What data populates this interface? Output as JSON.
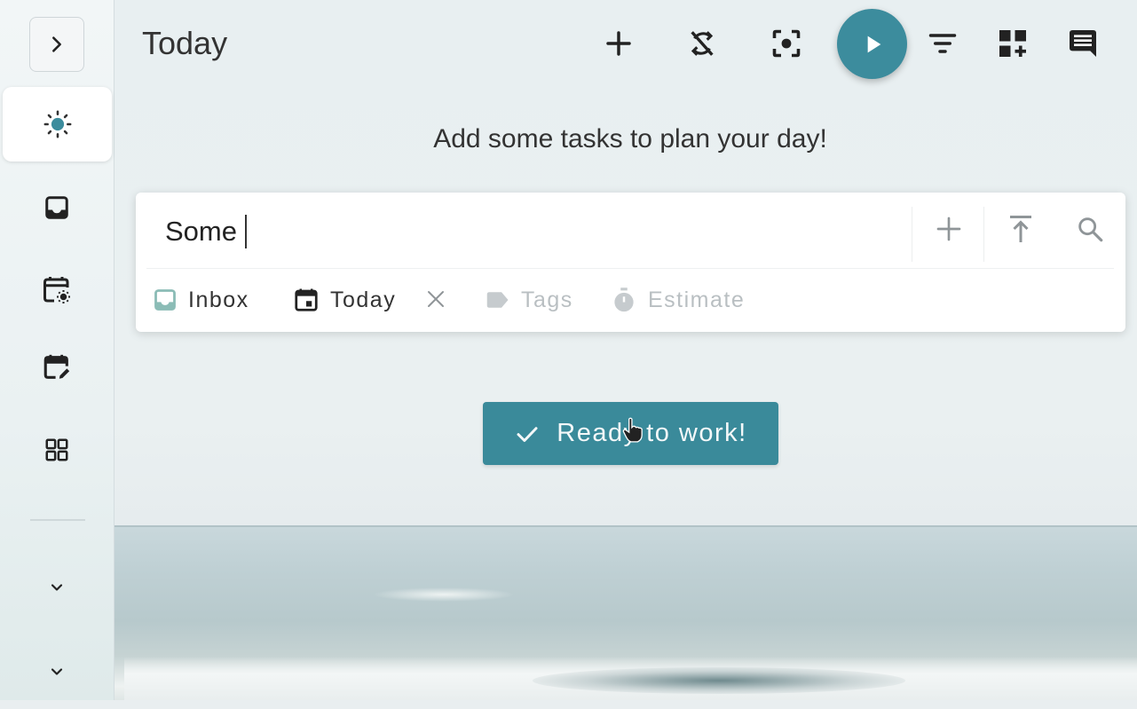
{
  "colors": {
    "accent": "#3c8c9d",
    "text": "#333333",
    "muted": "#b9bfc2",
    "inbox_icon": "#8bbcb6"
  },
  "sidebar": {
    "toggle_icon": "chevron-right-icon",
    "items": [
      {
        "name": "today",
        "icon": "sun-icon",
        "active": true
      },
      {
        "name": "inbox",
        "icon": "inbox-icon",
        "active": false
      },
      {
        "name": "planner",
        "icon": "calendar-sun-icon",
        "active": false
      },
      {
        "name": "scheduled",
        "icon": "calendar-edit-icon",
        "active": false
      },
      {
        "name": "boards",
        "icon": "grid-icon",
        "active": false
      }
    ],
    "expanders": [
      "chevron-down-icon",
      "chevron-down-icon"
    ]
  },
  "header": {
    "title": "Today",
    "actions": [
      "add-icon",
      "sync-off-icon",
      "focus-icon",
      "play-icon",
      "filter-icon",
      "add-widget-icon",
      "comment-icon"
    ]
  },
  "main": {
    "empty_message": "Add some tasks to plan your day!",
    "add_task": {
      "value": "Some",
      "actions": [
        "plus-icon",
        "move-to-top-icon",
        "search-icon"
      ],
      "chips": {
        "project": "Inbox",
        "due": "Today",
        "tags": "Tags",
        "estimate": "Estimate"
      }
    },
    "ready_button": "Ready to work!"
  }
}
